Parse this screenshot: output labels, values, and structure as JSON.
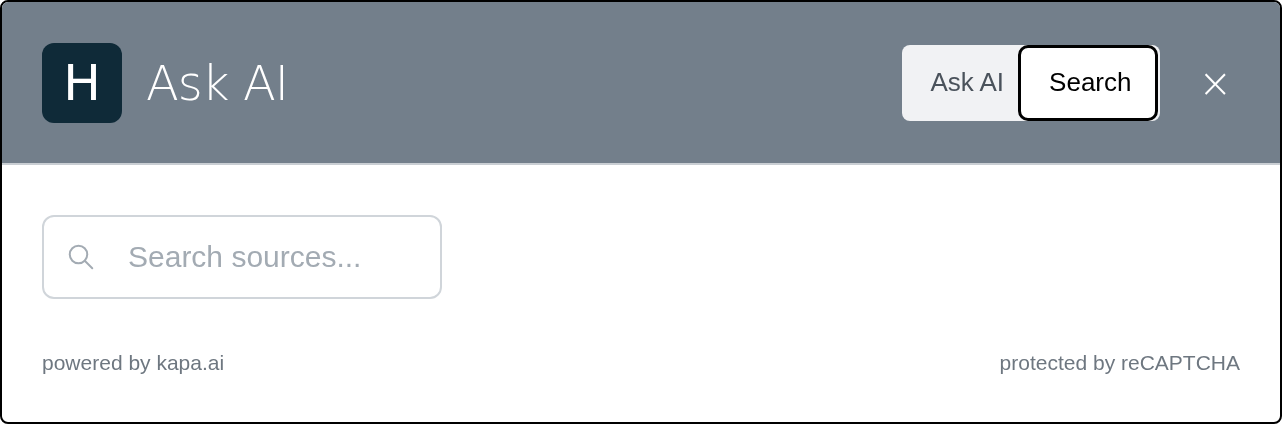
{
  "header": {
    "logo": "H",
    "title": "Ask AI"
  },
  "mode_tabs": [
    {
      "label": "Ask AI",
      "selected": false
    },
    {
      "label": "Search",
      "selected": true
    }
  ],
  "close": "×",
  "search": {
    "placeholder": "Search sources..."
  },
  "footer": {
    "left": "powered by kapa.ai",
    "right": "protected by reCAPTCHA"
  }
}
